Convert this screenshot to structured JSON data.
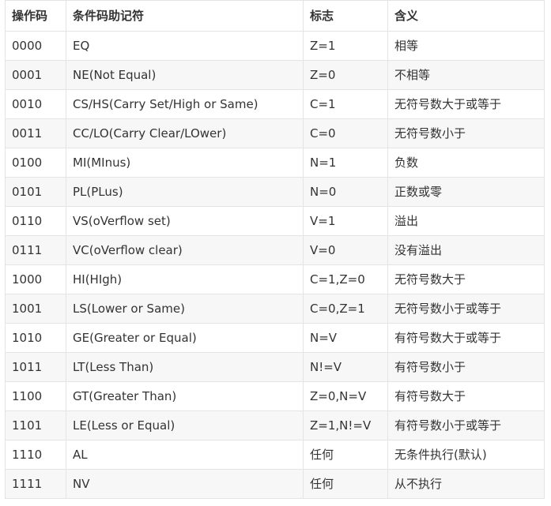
{
  "table": {
    "headers": [
      "操作码",
      "条件码助记符",
      "标志",
      "含义"
    ],
    "rows": [
      [
        "0000",
        "EQ",
        "Z=1",
        "相等"
      ],
      [
        "0001",
        "NE(Not Equal)",
        "Z=0",
        "不相等"
      ],
      [
        "0010",
        "CS/HS(Carry Set/High or Same)",
        "C=1",
        "无符号数大于或等于"
      ],
      [
        "0011",
        "CC/LO(Carry Clear/LOwer)",
        "C=0",
        "无符号数小于"
      ],
      [
        "0100",
        "MI(MInus)",
        "N=1",
        "负数"
      ],
      [
        "0101",
        "PL(PLus)",
        "N=0",
        "正数或零"
      ],
      [
        "0110",
        "VS(oVerflow set)",
        "V=1",
        "溢出"
      ],
      [
        "0111",
        "VC(oVerflow clear)",
        "V=0",
        "没有溢出"
      ],
      [
        "1000",
        "HI(HIgh)",
        "C=1,Z=0",
        "无符号数大于"
      ],
      [
        "1001",
        "LS(Lower or Same)",
        "C=0,Z=1",
        "无符号数小于或等于"
      ],
      [
        "1010",
        "GE(Greater or Equal)",
        "N=V",
        "有符号数大于或等于"
      ],
      [
        "1011",
        "LT(Less Than)",
        "N!=V",
        "有符号数小于"
      ],
      [
        "1100",
        "GT(Greater Than)",
        "Z=0,N=V",
        "有符号数大于"
      ],
      [
        "1101",
        "LE(Less or Equal)",
        "Z=1,N!=V",
        "有符号数小于或等于"
      ],
      [
        "1110",
        "AL",
        "任何",
        "无条件执行(默认)"
      ],
      [
        "1111",
        "NV",
        "任何",
        "从不执行"
      ]
    ]
  }
}
